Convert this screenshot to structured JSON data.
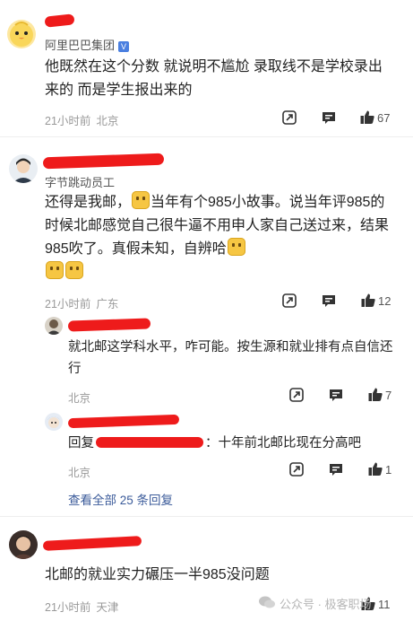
{
  "comments": [
    {
      "org": "阿里巴巴集团",
      "verified": "V",
      "text": "他既然在这个分数 就说明不尴尬 录取线不是学校录出来的 而是学生报出来的",
      "time": "21小时前",
      "location": "北京",
      "likes": "67"
    },
    {
      "org": "字节跳动员工",
      "text_a": "还得是我邮，",
      "text_b": "当年有个985小故事。说当年评985的时候北邮感觉自己很牛逼不用申人家自己送过来，结果985吹了。真假未知，自辨哈",
      "time": "21小时前",
      "location": "广东",
      "likes": "12",
      "replies": [
        {
          "text": "就北邮这学科水平，咋可能。按生源和就业排有点自信还行",
          "location": "北京",
          "likes": "7"
        },
        {
          "prefix": "回复",
          "text": "：十年前北邮比现在分高吧",
          "location": "北京",
          "likes": "1"
        }
      ],
      "more_replies": "查看全部 25 条回复"
    },
    {
      "text": "北邮的就业实力碾压一半985没问题",
      "time": "21小时前",
      "location": "天津",
      "likes": "11"
    }
  ],
  "watermark": "公众号 · 极客职场",
  "icons": {
    "share": "share-square-icon",
    "comment": "comment-bubble-icon",
    "like": "thumbs-up-icon",
    "wechat": "wechat-logo-icon"
  },
  "colors": {
    "redaction": "#ee1b1b",
    "link": "#3b5b9a",
    "meta": "#999999",
    "verified": "#4a7fe0"
  }
}
